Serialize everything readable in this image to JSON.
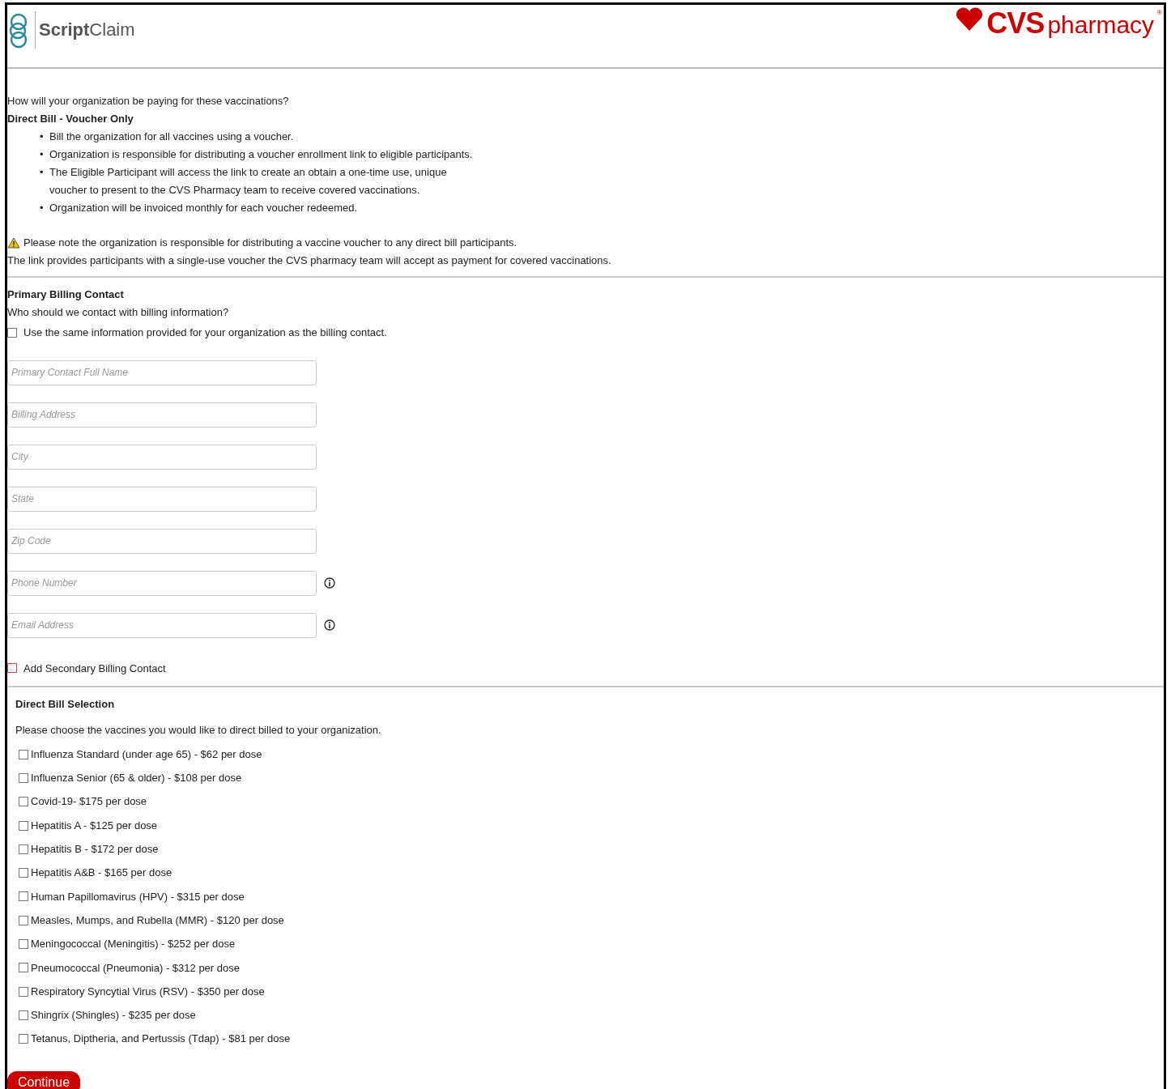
{
  "header": {
    "app_logo": "**Script**Claim",
    "brand_logo": {
      "name": "CVS",
      "tagline": "pharmacy",
      "mark": "®"
    }
  },
  "payment": {
    "question": "How will your organization be paying for these vaccinations?",
    "option_title": "Direct Bill - Voucher Only",
    "bullets": [
      {
        "marker": "•",
        "text": "Bill the organization for all vaccines using a voucher."
      },
      {
        "marker": "•",
        "text": "Organization is responsible for distributing a voucher enrollment link to eligible participants."
      },
      {
        "marker": "•",
        "text": "The Eligible Participant will access the link to create an obtain a one-time use, unique voucher to present to the CVS Pharmacy team to receive covered vaccinations."
      },
      {
        "marker": "•",
        "text": "Organization will be invoiced monthly for each voucher redeemed."
      }
    ],
    "warning": "Please note the organization is responsible for distributing a vaccine voucher to any direct bill participants.",
    "note": "The link provides participants with a single-use voucher the CVS pharmacy team will accept as payment for covered vaccinations."
  },
  "billing_contact": {
    "title": "Primary Billing Contact",
    "question": "Who should we contact with billing information?",
    "same_info": {
      "label": "Use the same information provided for your organization as the billing contact.",
      "checked": false,
      "invalid": false
    },
    "fields": [
      {
        "placeholder": "Primary Contact Full Name",
        "info": false
      },
      {
        "placeholder": "Billing Address",
        "info": false
      },
      {
        "placeholder": "City",
        "info": false
      },
      {
        "placeholder": "State",
        "info": false
      },
      {
        "placeholder": "Zip Code",
        "info": false
      },
      {
        "placeholder": "Phone Number",
        "info": true
      },
      {
        "placeholder": "Email Address",
        "info": true
      }
    ],
    "secondary": {
      "label": "Add Secondary Billing Contact",
      "checked": false,
      "invalid": true
    }
  },
  "direct_bill": {
    "title": "Direct Bill Selection",
    "instruction": "Please choose the vaccines you would like to direct billed to your organization.",
    "vaccines": [
      {
        "label": "Influenza Standard (under age 65) - $62 per dose",
        "checked": false
      },
      {
        "label": "Influenza Senior (65 & older) - $108 per dose",
        "checked": false
      },
      {
        "label": "Covid-19- $175 per dose",
        "checked": false
      },
      {
        "label": "Hepatitis A - $125 per dose",
        "checked": false
      },
      {
        "label": "Hepatitis B - $172 per dose",
        "checked": false
      },
      {
        "label": "Hepatitis A&B - $165 per dose",
        "checked": false
      },
      {
        "label": "Human Papillomavirus (HPV) - $315 per dose",
        "checked": false
      },
      {
        "label": "Measles, Mumps, and Rubella (MMR) - $120 per dose",
        "checked": false
      },
      {
        "label": "Meningococcal (Meningitis) - $252 per dose",
        "checked": false
      },
      {
        "label": "Pneumococcal (Pneumonia) - $312 per dose",
        "checked": false
      },
      {
        "label": "Respiratory Syncytial Virus (RSV) - $350 per dose",
        "checked": false
      },
      {
        "label": "Shingrix (Shingles) - $235 per dose",
        "checked": false
      },
      {
        "label": "Tetanus, Diptheria, and Pertussis (Tdap) - $81 per dose",
        "checked": false
      }
    ]
  },
  "continue_button": "Continue"
}
